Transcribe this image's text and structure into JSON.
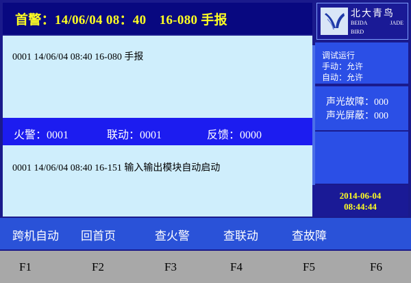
{
  "header": {
    "first_alarm": "首警：14/06/04 08：40　16-080  手报"
  },
  "main": {
    "fire_record": "0001 14/06/04 08:40 16-080  手报",
    "counters": {
      "fire": "火警：0001",
      "linkage": "联动：0001",
      "feedback": "反馈：0000"
    },
    "linkage_record": "0001 14/06/04 08:40 16-151  输入输出模块自动启动"
  },
  "logo": {
    "title": "北大青鸟",
    "en_line1": "BEIDA",
    "en_line2": "JADE",
    "en_line3": "BIRD"
  },
  "status": {
    "mode": "调试运行",
    "manual": "手动：允许",
    "auto": "自动：允许"
  },
  "faults": {
    "sound_light_fault": "声光故障：000",
    "sound_light_mask": "声光屏蔽：000"
  },
  "datetime": {
    "date": "2014-06-04",
    "time": "08:44:44"
  },
  "menu": [
    {
      "label": "跨机自动"
    },
    {
      "label": "回首页"
    },
    {
      "label": "查火警"
    },
    {
      "label": "查联动"
    },
    {
      "label": "查故障"
    }
  ],
  "fkeys": [
    {
      "label": "F1"
    },
    {
      "label": "F2"
    },
    {
      "label": "F3"
    },
    {
      "label": "F4"
    },
    {
      "label": "F5"
    },
    {
      "label": "F6"
    }
  ],
  "colors": {
    "header_bg": "#080880",
    "alert_text": "#ffff22",
    "panel_light": "#cfeefc",
    "counter_bar": "#1c1cf0",
    "side_panel": "#2b4fe6",
    "menu_bar": "#2a52d8",
    "fkey_bar": "#a8a8a8"
  }
}
